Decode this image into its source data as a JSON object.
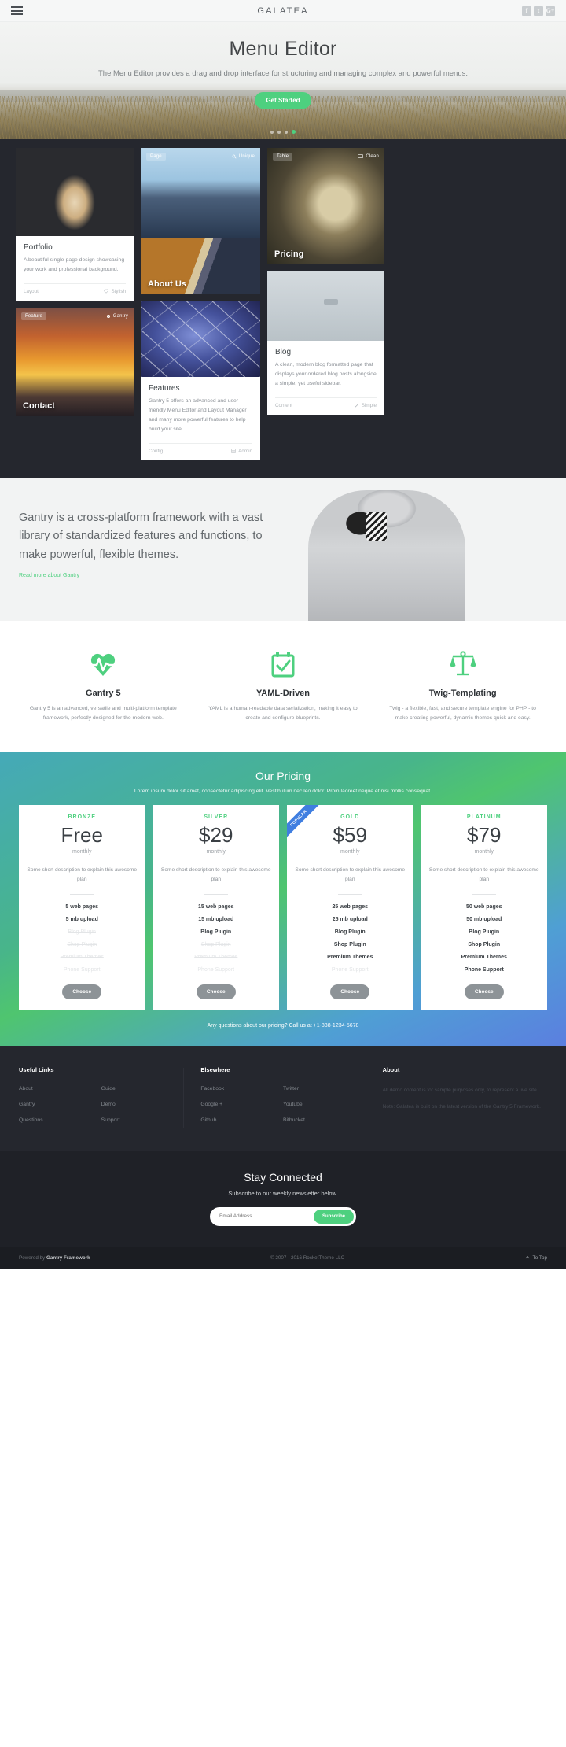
{
  "header": {
    "brand": "GALATEA",
    "menu_icon": "hamburger-icon",
    "social": [
      {
        "name": "facebook",
        "glyph": "f"
      },
      {
        "name": "twitter",
        "glyph": "t"
      },
      {
        "name": "google-plus",
        "glyph": "G+"
      }
    ]
  },
  "hero": {
    "title": "Menu Editor",
    "subtitle": "The Menu Editor provides a drag and drop interface for structuring and managing complex and powerful menus.",
    "cta": "Get Started",
    "dots": 4,
    "active_dot": 3
  },
  "showcase": {
    "portfolio": {
      "title": "Portfolio",
      "text": "A beautiful single-page design showcasing your work and professional background.",
      "foot_left": "Layout",
      "foot_right": "Stylish",
      "foot_right_icon": "heart-icon"
    },
    "about": {
      "chip_left": "Page",
      "chip_right": "Unique",
      "chip_right_icon": "search-icon",
      "caption": "About Us"
    },
    "pricing_tile": {
      "chip_left": "Table",
      "chip_right": "Clean",
      "chip_right_icon": "display-icon",
      "caption": "Pricing"
    },
    "contact": {
      "chip_left": "Feature",
      "chip_right": "Gantry",
      "chip_right_icon": "gear-icon",
      "caption": "Contact"
    },
    "features": {
      "title": "Features",
      "text": "Gantry 5 offers an advanced and user friendly Menu Editor and Layout Manager and many more powerful features to help build your site.",
      "foot_left": "Config",
      "foot_right": "Admin",
      "foot_right_icon": "grid-icon"
    },
    "blog": {
      "title": "Blog",
      "text": "A clean, modern blog formatted page that displays your ordered blog posts alongside a simple, yet useful sidebar.",
      "foot_left": "Content",
      "foot_right": "Simple",
      "foot_right_icon": "pencil-icon"
    }
  },
  "intro": {
    "heading": "Gantry is a cross-platform framework with a vast library of standardized features and functions, to make powerful, flexible themes.",
    "link": "Read more about Gantry"
  },
  "features": [
    {
      "icon": "heartbeat-icon",
      "title": "Gantry 5",
      "text": "Gantry 5 is an advanced, versatile and multi-platform template framework, perfectly designed for the modern web."
    },
    {
      "icon": "calendar-check-icon",
      "title": "YAML-Driven",
      "text": "YAML is a human-readable data serialization, making it easy to create and configure blueprints."
    },
    {
      "icon": "scales-icon",
      "title": "Twig-Templating",
      "text": "Twig - a flexible, fast, and secure template engine for PHP - to make creating powerful, dynamic themes quick and easy."
    }
  ],
  "pricing": {
    "title": "Our Pricing",
    "subtitle": "Lorem ipsum dolor sit amet, consectetur adipiscing elit. Vestibulum nec leo dolor. Proin laoreet neque et nisi mollis consequat.",
    "footer": "Any questions about our pricing? Call us at +1-888-1234-5678",
    "accent": "#4ed07f",
    "ribbon_label": "POPULAR",
    "plans": [
      {
        "name": "BRONZE",
        "price": "Free",
        "period": "monthly",
        "desc": "Some short description to explain this awesome plan",
        "features": [
          {
            "label": "5 web pages",
            "enabled": true
          },
          {
            "label": "5 mb upload",
            "enabled": true
          },
          {
            "label": "Blog Plugin",
            "enabled": false
          },
          {
            "label": "Shop Plugin",
            "enabled": false
          },
          {
            "label": "Premium Themes",
            "enabled": false
          },
          {
            "label": "Phone Support",
            "enabled": false
          }
        ],
        "button": "Choose",
        "ribbon": false
      },
      {
        "name": "SILVER",
        "price": "$29",
        "period": "monthly",
        "desc": "Some short description to explain this awesome plan",
        "features": [
          {
            "label": "15 web pages",
            "enabled": true
          },
          {
            "label": "15 mb upload",
            "enabled": true
          },
          {
            "label": "Blog Plugin",
            "enabled": true
          },
          {
            "label": "Shop Plugin",
            "enabled": false
          },
          {
            "label": "Premium Themes",
            "enabled": false
          },
          {
            "label": "Phone Support",
            "enabled": false
          }
        ],
        "button": "Choose",
        "ribbon": false
      },
      {
        "name": "GOLD",
        "price": "$59",
        "period": "monthly",
        "desc": "Some short description to explain this awesome plan",
        "features": [
          {
            "label": "25 web pages",
            "enabled": true
          },
          {
            "label": "25 mb upload",
            "enabled": true
          },
          {
            "label": "Blog Plugin",
            "enabled": true
          },
          {
            "label": "Shop Plugin",
            "enabled": true
          },
          {
            "label": "Premium Themes",
            "enabled": true
          },
          {
            "label": "Phone Support",
            "enabled": false
          }
        ],
        "button": "Choose",
        "ribbon": true
      },
      {
        "name": "PLATINUM",
        "price": "$79",
        "period": "monthly",
        "desc": "Some short description to explain this awesome plan",
        "features": [
          {
            "label": "50 web pages",
            "enabled": true
          },
          {
            "label": "50 mb upload",
            "enabled": true
          },
          {
            "label": "Blog Plugin",
            "enabled": true
          },
          {
            "label": "Shop Plugin",
            "enabled": true
          },
          {
            "label": "Premium Themes",
            "enabled": true
          },
          {
            "label": "Phone Support",
            "enabled": true
          }
        ],
        "button": "Choose",
        "ribbon": false
      }
    ]
  },
  "footer": {
    "useful_links": {
      "heading": "Useful Links",
      "items": [
        "About",
        "Guide",
        "Gantry",
        "Demo",
        "Questions",
        "Support"
      ]
    },
    "elsewhere": {
      "heading": "Elsewhere",
      "items": [
        "Facebook",
        "Twitter",
        "Google +",
        "Youtube",
        "Github",
        "Bitbucket"
      ]
    },
    "about": {
      "heading": "About",
      "p1": "All demo content is for sample purposes only, to represent a live site.",
      "p2": "Note: Galatea is built on the latest version of the Gantry 5 Framework."
    }
  },
  "newsletter": {
    "title": "Stay Connected",
    "subtitle": "Subscribe to our weekly newsletter below.",
    "placeholder": "Email Address",
    "button": "Subscribe"
  },
  "copyright": {
    "powered_prefix": "Powered by ",
    "powered_brand": "Gantry Framework",
    "center": "© 2007 - 2016 RocketTheme LLC",
    "to_top": "To Top",
    "to_top_icon": "chevron-up-icon"
  }
}
